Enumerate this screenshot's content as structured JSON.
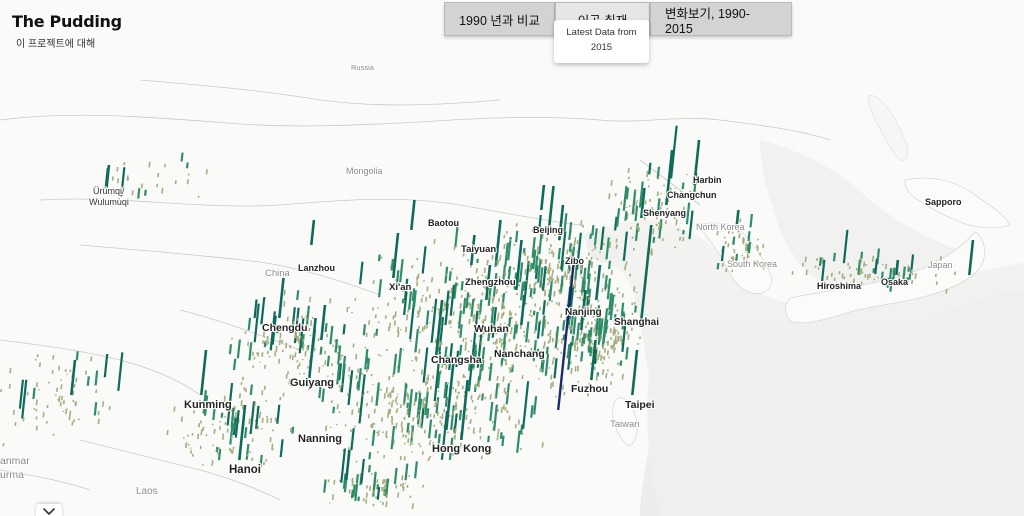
{
  "brand": {
    "title": "The Pudding",
    "about_link": "이 프로젝트에 대해"
  },
  "tabs": [
    {
      "label": "1990 년과 비교",
      "active": false
    },
    {
      "label": "이곳 취재",
      "active": true
    },
    {
      "label": "변화보기, 1990-2015",
      "active": false
    }
  ],
  "tooltip": {
    "line1": "Latest Data from",
    "line2": "2015"
  },
  "map_labels": {
    "major": [
      "Harbin",
      "Changchun",
      "Shenyang",
      "Sapporo",
      "Baotou",
      "Beijing",
      "Taiyuan",
      "Lanzhou",
      "Zibo",
      "Zhengzhou",
      "Xi'an",
      "Hiroshima",
      "Osaka",
      "Nanjing",
      "Chengdu",
      "Shanghai",
      "Wuhan",
      "Nanchang",
      "Changsha",
      "Guiyang",
      "Fuzhou",
      "Kunming",
      "Taipei",
      "Nanning",
      "Hong Kong",
      "Hanoi"
    ],
    "minor": [
      "Russia",
      "Mongolia",
      "Ürümqi/",
      "Wulumuqi",
      "China",
      "North Korea",
      "South Korea",
      "Japan",
      "Taiwan",
      "Laos",
      "anmar",
      "urma"
    ]
  },
  "colors": {
    "spike_dark": "#0e6b5a",
    "spike_mid": "#2f8d6a",
    "spike_light": "#a6ad7e",
    "spike_highlight": "#1b2a6b",
    "land": "#fbfbf9",
    "water": "#f0f0ee",
    "border": "#c9c9c9"
  },
  "icons": {
    "scroll_toggle": "chevron-down-icon"
  }
}
